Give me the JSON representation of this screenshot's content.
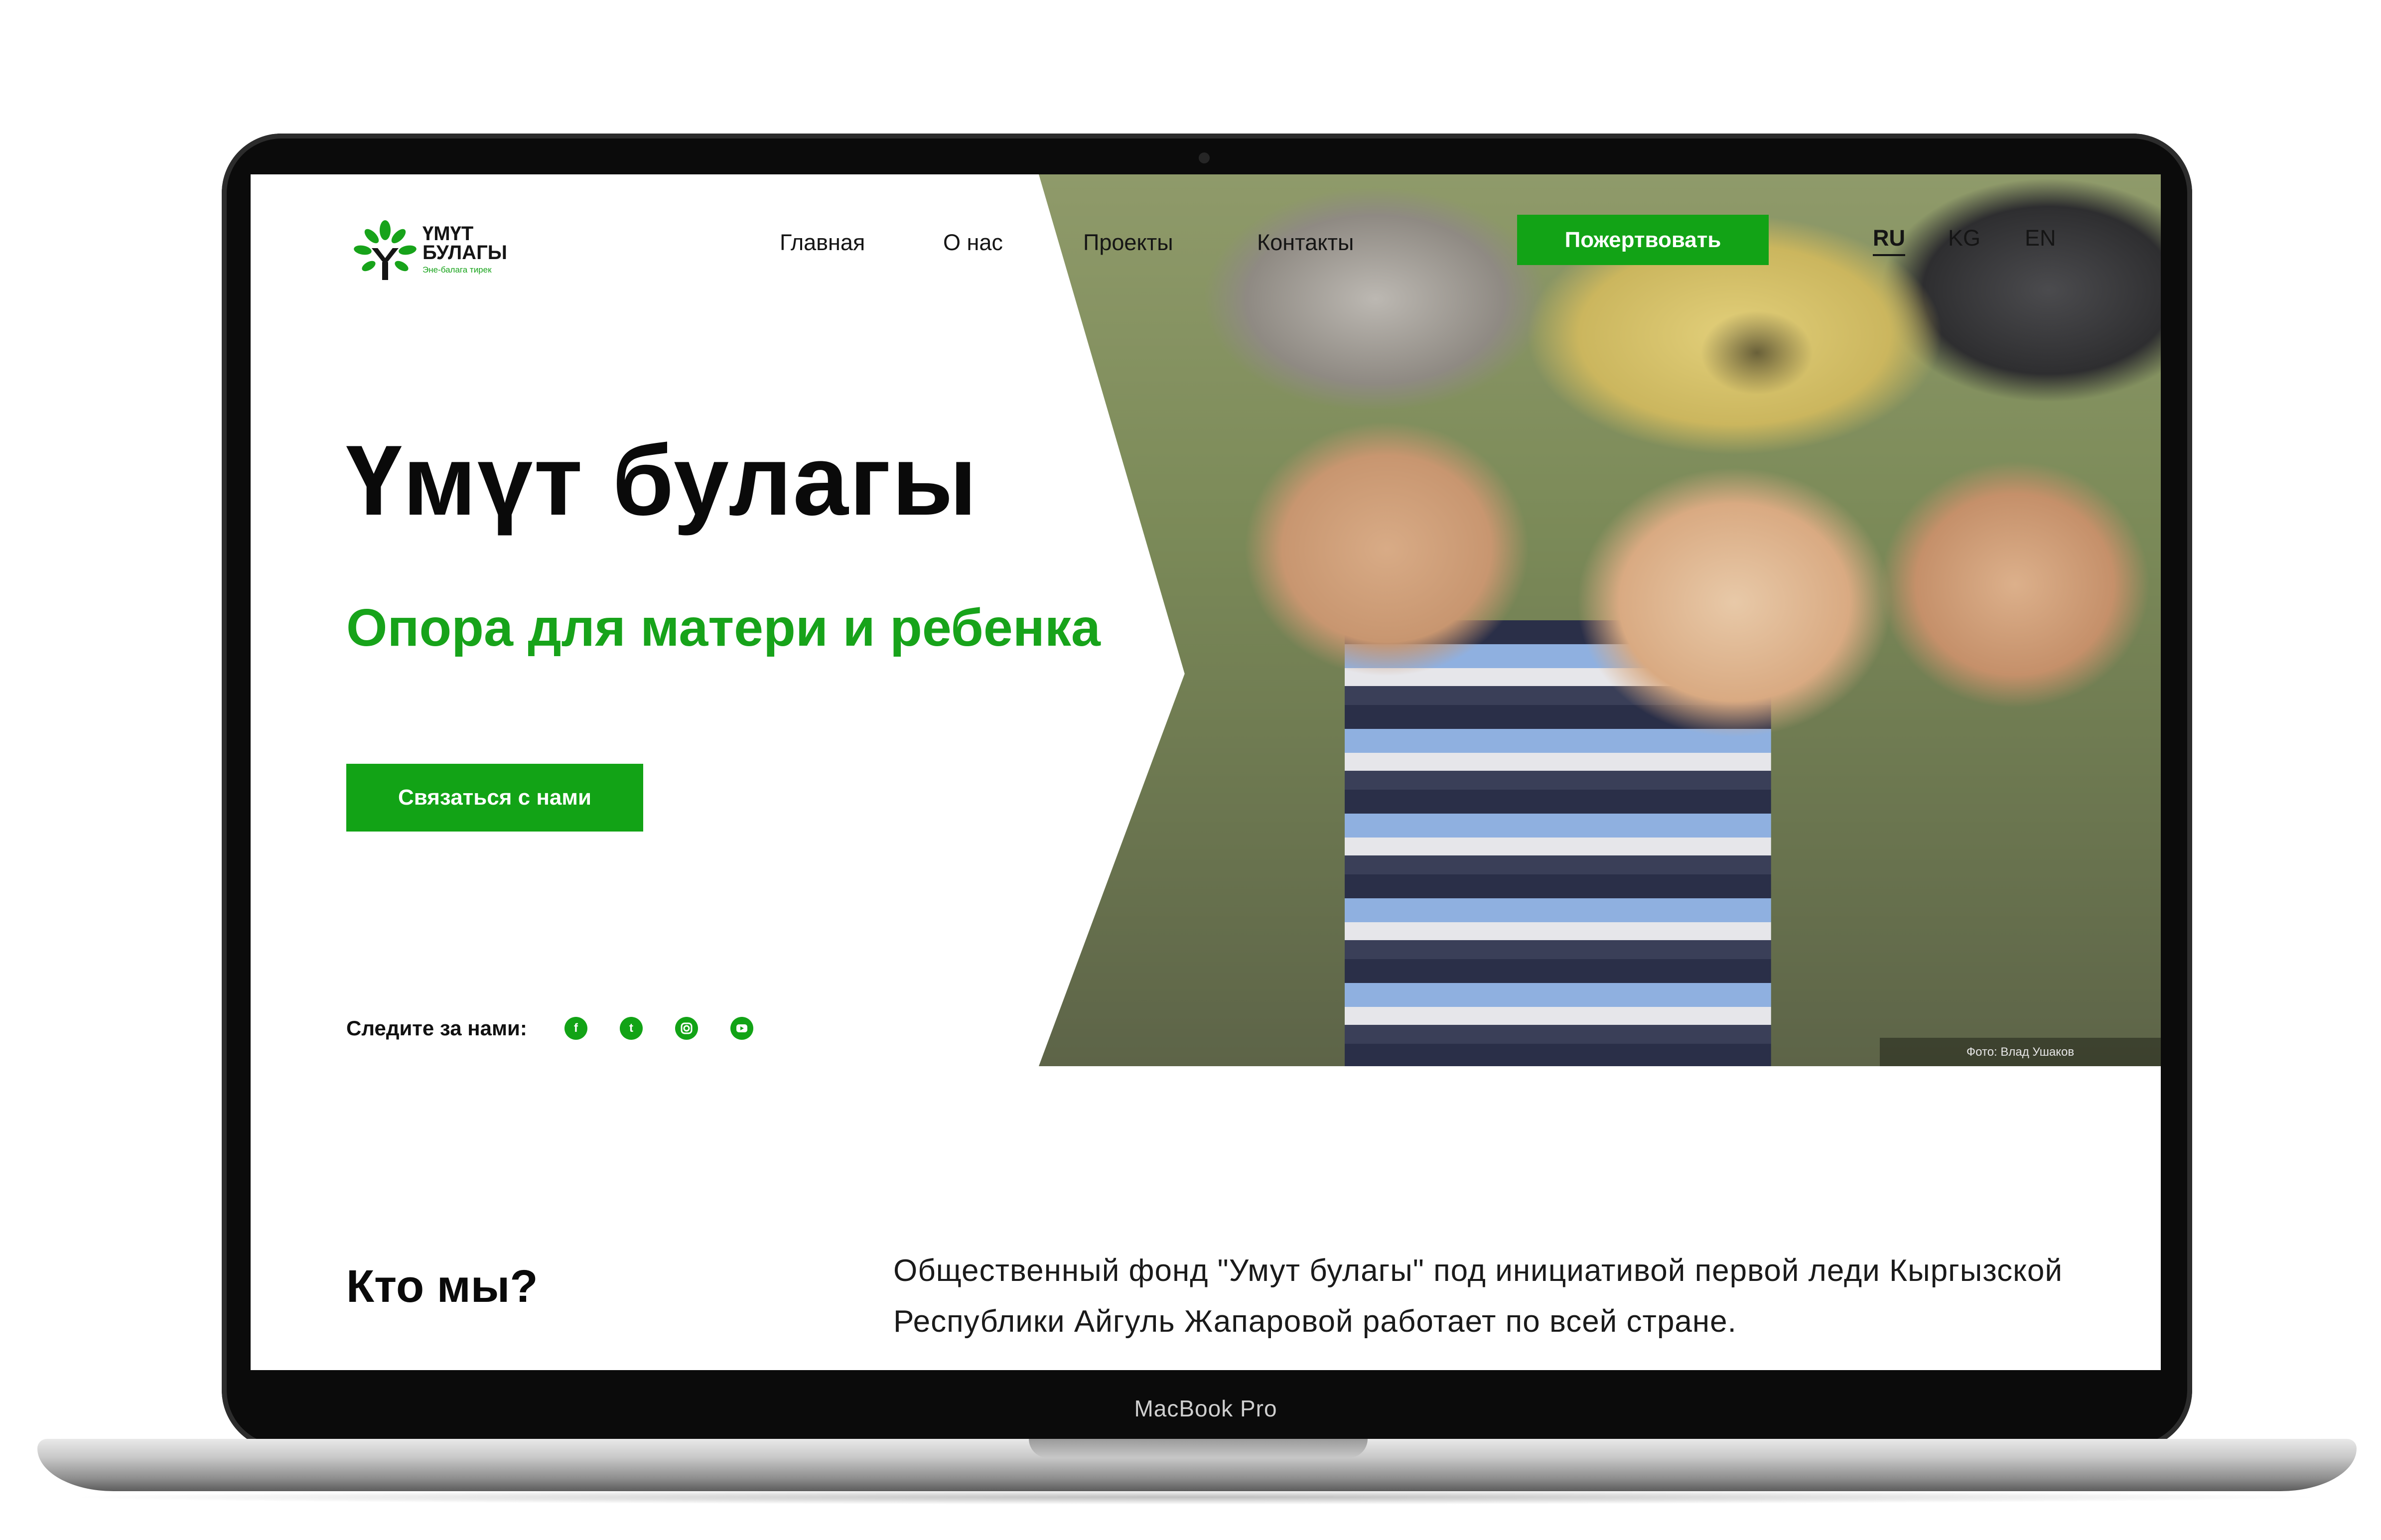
{
  "brand": {
    "name": "ҮМҮТ БУЛАГЫ",
    "tagline": "Эне-балага тирек",
    "accent_color": "#12a316"
  },
  "nav": {
    "items": [
      "Главная",
      "О нас",
      "Проекты",
      "Контакты"
    ],
    "donate_label": "Пожертвовать",
    "languages": [
      "RU",
      "KG",
      "EN"
    ],
    "active_language": "RU"
  },
  "hero": {
    "title": "Үмүт булагы",
    "subtitle": "Опора для матери и ребенка",
    "cta_label": "Связаться с нами",
    "photo_credit": "Фото: Влад Ушаков"
  },
  "social": {
    "label": "Следите за нами:",
    "icons": [
      "facebook-icon",
      "twitter-icon",
      "instagram-icon",
      "youtube-icon"
    ]
  },
  "about": {
    "title": "Кто мы?",
    "text": "Общественный фонд \"Умут булагы\" под инициативой первой леди Кыргызской Республики Айгуль Жапаровой работает по всей стране."
  },
  "device": {
    "model": "MacBook Pro"
  }
}
